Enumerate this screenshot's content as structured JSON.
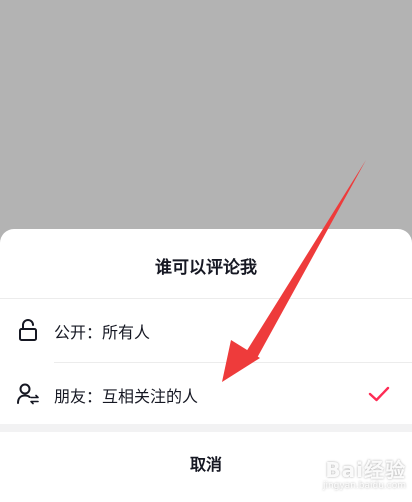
{
  "sheet": {
    "title": "谁可以评论我",
    "options": [
      {
        "label": "公开：所有人",
        "icon": "unlock-icon",
        "selected": false
      },
      {
        "label": "朋友：互相关注的人",
        "icon": "mutual-friends-icon",
        "selected": true
      }
    ],
    "cancel_label": "取消"
  },
  "watermark": {
    "brand": "Bai经验",
    "url": "jingyan.baidu.com"
  },
  "colors": {
    "overlay": "#b3b3b3",
    "sheet_bg": "#ffffff",
    "text": "#161823",
    "check": "#fe2c55",
    "arrow": "#ee3b3b"
  }
}
